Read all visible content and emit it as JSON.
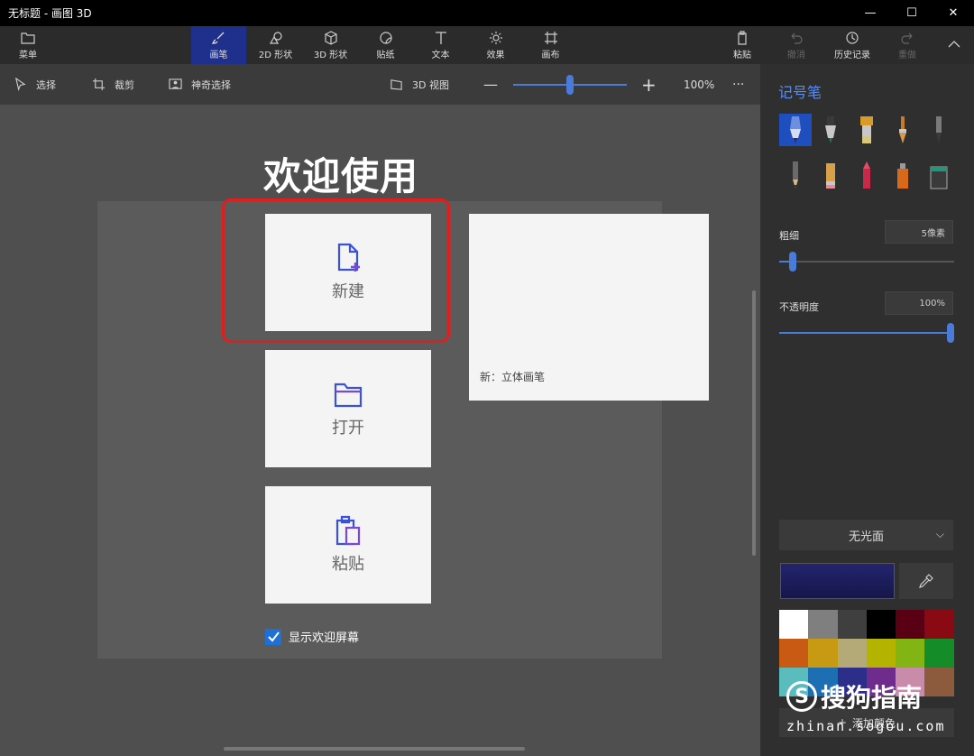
{
  "window": {
    "title": "无标题 - 画图 3D",
    "minimize": "—",
    "maximize": "☐",
    "close": "✕"
  },
  "ribbon": {
    "menu": "菜单",
    "tabs": [
      "画笔",
      "2D 形状",
      "3D 形状",
      "贴纸",
      "文本",
      "效果",
      "画布"
    ],
    "paste": "粘贴",
    "undo": "撤消",
    "history": "历史记录",
    "redo": "重做"
  },
  "toolbar": {
    "select": "选择",
    "crop": "裁剪",
    "magic_select": "神奇选择",
    "view3d": "3D 视图",
    "zoom_minus": "—",
    "zoom_plus": "+",
    "zoom_level": "100%",
    "more": "···"
  },
  "welcome": {
    "title": "欢迎使用",
    "new_label": "新建",
    "open_label": "打开",
    "paste_label": "粘贴",
    "preview_caption": "新：立体画笔",
    "show_welcome": "显示欢迎屏幕"
  },
  "panel": {
    "title": "记号笔",
    "thickness_label": "粗细",
    "thickness_value": "5像素",
    "thickness_level": 0.06,
    "opacity_label": "不透明度",
    "opacity_value": "100%",
    "opacity_level": 1.0,
    "finish": "无光面",
    "add_color": "添加颜色",
    "current_color": "#23246e",
    "palette": [
      "#ffffff",
      "#7f7f7f",
      "#3f3f3f",
      "#000000",
      "#5a0014",
      "#8a0a14",
      "#c85a14",
      "#c89a14",
      "#b4aa78",
      "#b4b400",
      "#82b414",
      "#148c28",
      "#5abcbc",
      "#1e6eb4",
      "#2c2e8a",
      "#6e2c8c",
      "#c88caa",
      "#8c5a3c"
    ]
  },
  "watermark": {
    "brand": "搜狗指南",
    "url": "zhinan.sogou.com",
    "logo_letter": "S"
  }
}
